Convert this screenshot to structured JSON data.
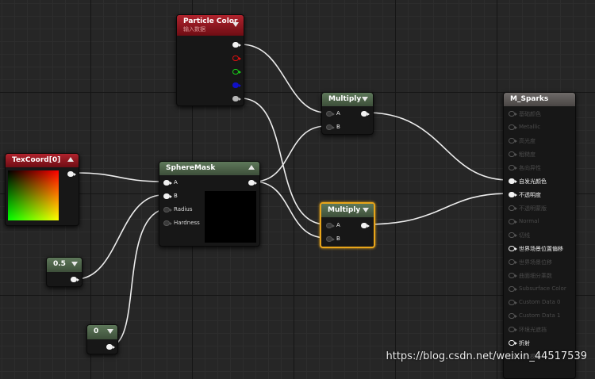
{
  "nodes": {
    "particle_color": {
      "title": "Particle Color",
      "subtitle": "输入数据"
    },
    "texcoord": {
      "title": "TexCoord[0]"
    },
    "spheremask": {
      "title": "SphereMask",
      "pins": {
        "a": "A",
        "b": "B",
        "radius": "Radius",
        "hardness": "Hardness"
      }
    },
    "const_05": {
      "title": "0.5"
    },
    "const_0": {
      "title": "0"
    },
    "multiply_top": {
      "title": "Multiply",
      "pins": {
        "a": "A",
        "b": "B"
      }
    },
    "multiply_bottom": {
      "title": "Multiply",
      "pins": {
        "a": "A",
        "b": "B"
      }
    },
    "material": {
      "title": "M_Sparks",
      "pins": [
        "基础颜色",
        "Metallic",
        "高光度",
        "粗糙度",
        "各向异性",
        "自发光颜色",
        "不透明度",
        "不透明蒙版",
        "Normal",
        "切线",
        "世界场景位置偏移",
        "世界场景位移",
        "曲面细分乘数",
        "Subsurface Color",
        "Custom Data 0",
        "Custom Data 1",
        "环境光遮挡",
        "折射",
        "着色模型"
      ]
    }
  },
  "watermark": "https://blog.csdn.net/weixin_44517539",
  "colors": {
    "selection": "#e8a51a",
    "wire": "#ececec",
    "header_red": "#b0232d",
    "header_green": "#5e785a"
  }
}
